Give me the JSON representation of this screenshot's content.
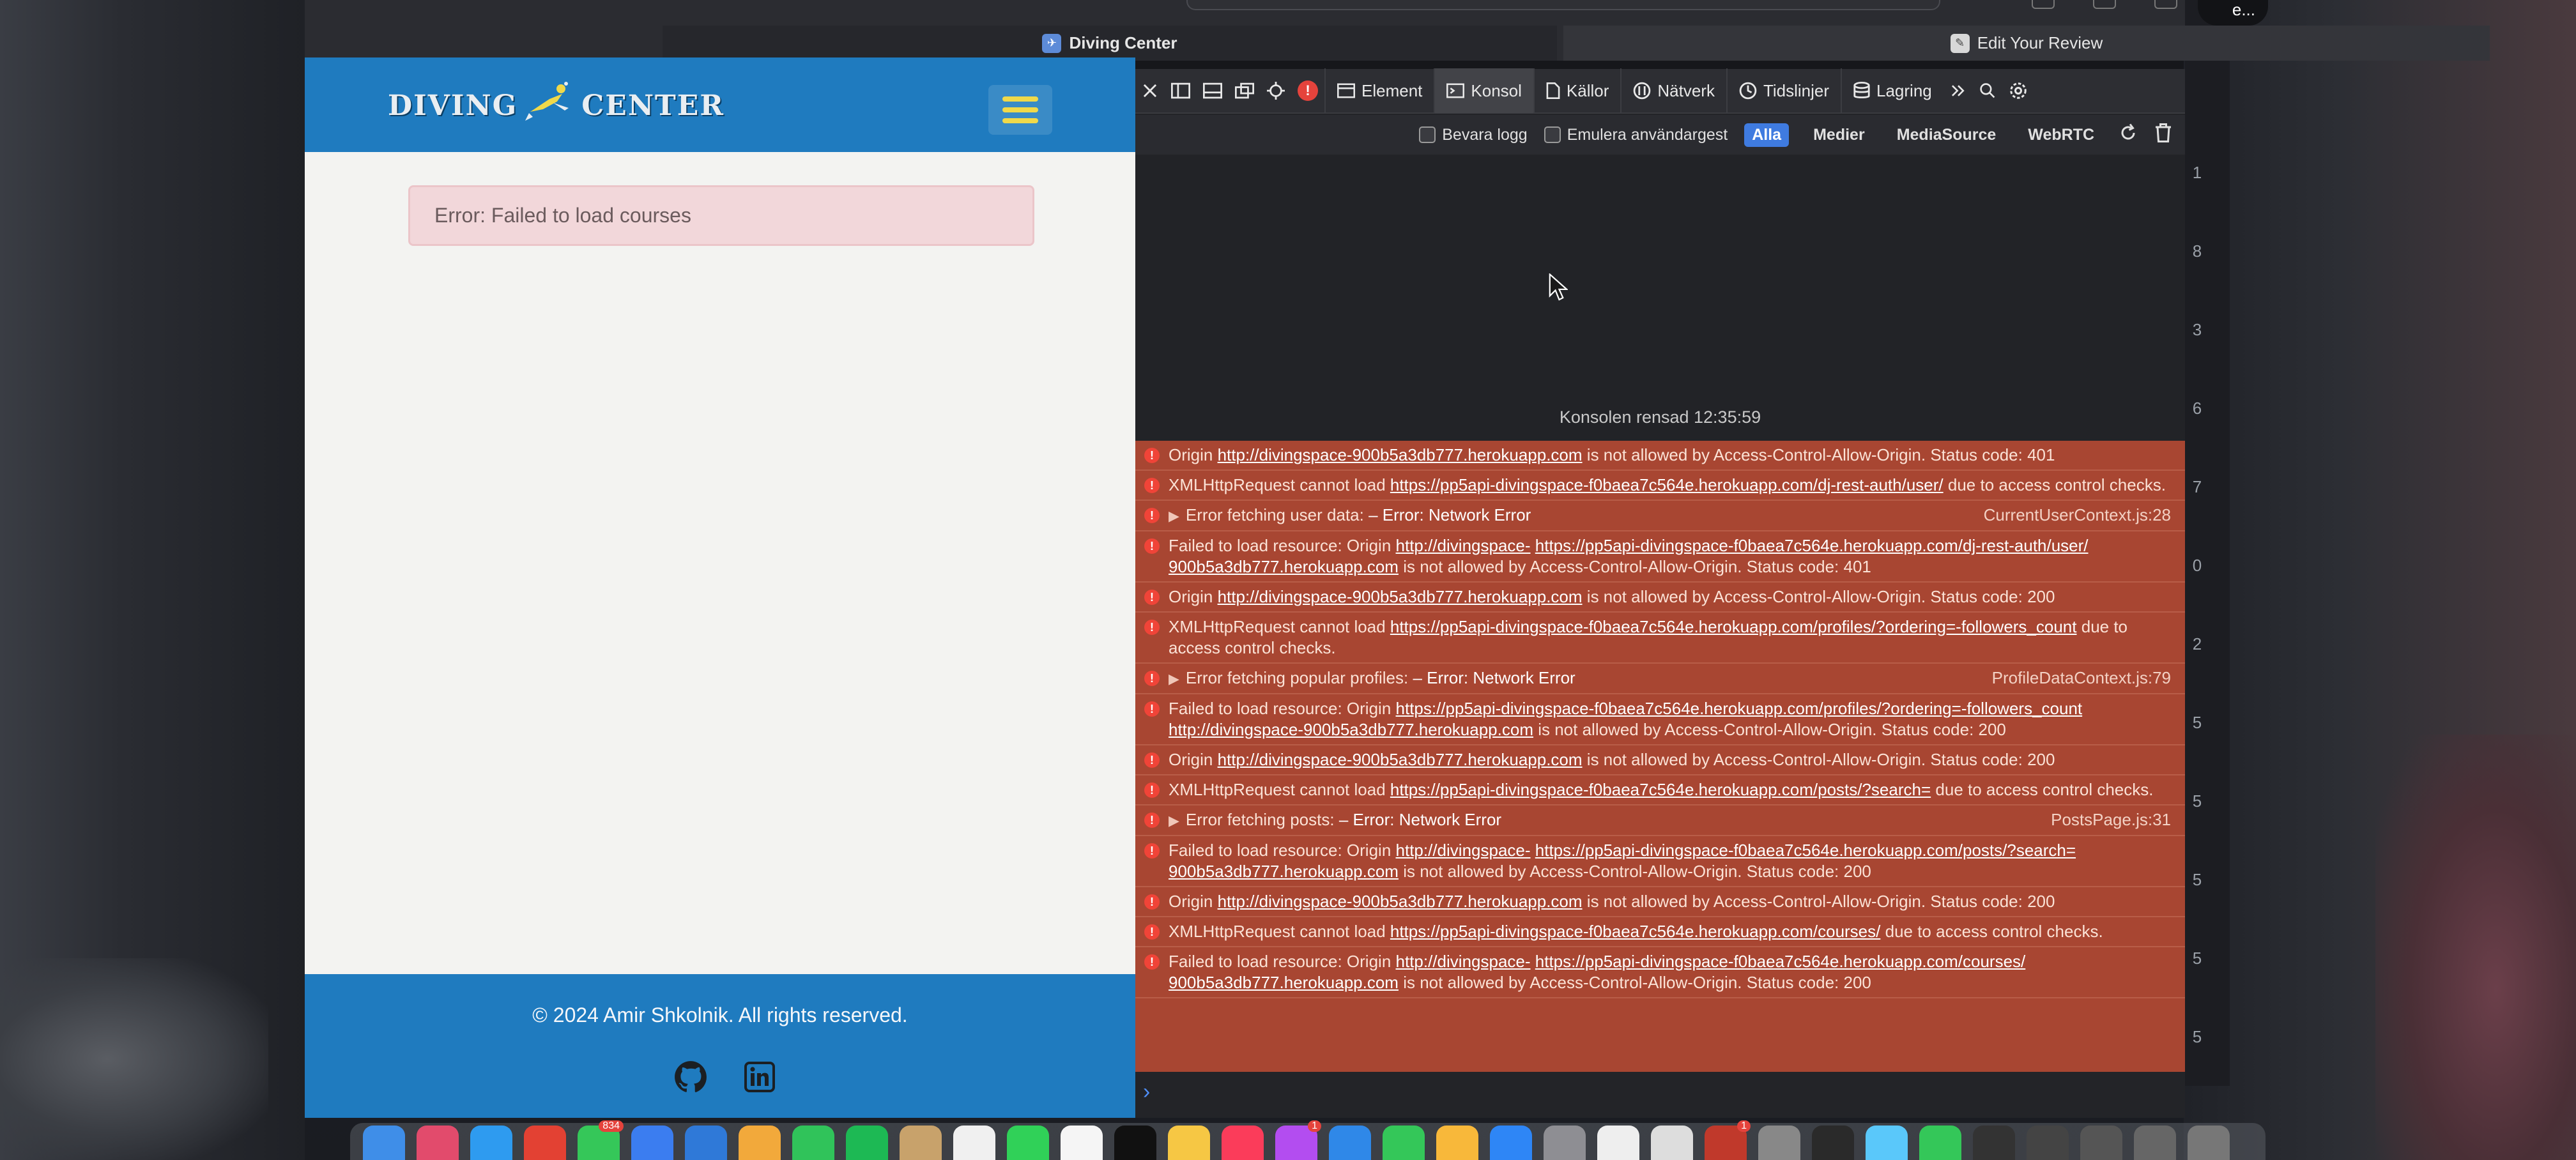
{
  "browser": {
    "tabs": [
      {
        "label": "Diving Center",
        "active": true
      },
      {
        "label": "Edit Your Review",
        "active": false
      }
    ],
    "top_right_text": "e..."
  },
  "site": {
    "logo_text_left": "DIVING",
    "logo_text_right": "CENTER",
    "error_message": "Error: Failed to load courses",
    "footer": {
      "copyright": "© 2024 Amir Shkolnik. All rights reserved.",
      "social": [
        "github-icon",
        "linkedin-icon"
      ]
    },
    "colors": {
      "header": "#1f7bbf",
      "hamburger": "#f0d94a",
      "error_bg": "#f2d7da"
    }
  },
  "devtools": {
    "tabs": [
      "Element",
      "Konsol",
      "Källor",
      "Nätverk",
      "Tidslinjer",
      "Lagring"
    ],
    "active_tab": "Konsol",
    "filter": {
      "preserve_log": "Bevara logg",
      "emulate": "Emulera användargest",
      "levels": [
        "Alla",
        "Medier",
        "MediaSource",
        "WebRTC"
      ],
      "active_level": "Alla"
    },
    "cleared_text": "Konsolen rensad 12:35:59",
    "messages": [
      {
        "parts": [
          {
            "t": "Origin "
          },
          {
            "l": "http://divingspace-900b5a3db777.herokuapp.com"
          },
          {
            "t": " is not allowed by Access-Control-Allow-Origin. Status code: 401"
          }
        ]
      },
      {
        "parts": [
          {
            "t": "XMLHttpRequest cannot load "
          },
          {
            "l": "https://pp5api-divingspace-f0baea7c564e.herokuapp.com/dj-rest-auth/user/"
          },
          {
            "t": " due to access control checks."
          }
        ]
      },
      {
        "group": true,
        "label": "Error fetching user data:",
        "detail": "– Error: Network Error",
        "source": "CurrentUserContext.js:28"
      },
      {
        "parts": [
          {
            "t": "Failed to load resource: Origin "
          },
          {
            "l": "http://divingspace-"
          },
          {
            "l": "https://pp5api-divingspace-f0baea7c564e.herokuapp.com/dj-rest-auth/user/"
          },
          {
            "l": "900b5a3db777.herokuapp.com"
          },
          {
            "t": " is not allowed by Access-Control-Allow-Origin. Status code: 401"
          }
        ]
      },
      {
        "parts": [
          {
            "t": "Origin "
          },
          {
            "l": "http://divingspace-900b5a3db777.herokuapp.com"
          },
          {
            "t": " is not allowed by Access-Control-Allow-Origin. Status code: 200"
          }
        ]
      },
      {
        "parts": [
          {
            "t": "XMLHttpRequest cannot load "
          },
          {
            "l": "https://pp5api-divingspace-f0baea7c564e.herokuapp.com/profiles/?ordering=-followers_count"
          },
          {
            "t": " due to access control checks."
          }
        ]
      },
      {
        "group": true,
        "label": "Error fetching popular profiles:",
        "detail": "– Error: Network Error",
        "source": "ProfileDataContext.js:79"
      },
      {
        "parts": [
          {
            "t": "Failed to load resource: Origin  "
          },
          {
            "l": "https://pp5api-divingspace-f0baea7c564e.herokuapp.com/profiles/?ordering=-followers_count"
          },
          {
            "l": "http://divingspace-900b5a3db777.herokuapp.com"
          },
          {
            "t": " is not allowed by Access-Control-Allow-Origin. Status code: 200"
          }
        ]
      },
      {
        "parts": [
          {
            "t": "Origin "
          },
          {
            "l": "http://divingspace-900b5a3db777.herokuapp.com"
          },
          {
            "t": " is not allowed by Access-Control-Allow-Origin. Status code: 200"
          }
        ]
      },
      {
        "parts": [
          {
            "t": "XMLHttpRequest cannot load "
          },
          {
            "l": "https://pp5api-divingspace-f0baea7c564e.herokuapp.com/posts/?search="
          },
          {
            "t": " due to access control checks."
          }
        ]
      },
      {
        "group": true,
        "label": "Error fetching posts:",
        "detail": "– Error: Network Error",
        "source": "PostsPage.js:31"
      },
      {
        "parts": [
          {
            "t": "Failed to load resource: Origin "
          },
          {
            "l": "http://divingspace-"
          },
          {
            "l": "https://pp5api-divingspace-f0baea7c564e.herokuapp.com/posts/?search="
          },
          {
            "l": "900b5a3db777.herokuapp.com"
          },
          {
            "t": " is not allowed by Access-Control-Allow-Origin. Status code: 200"
          }
        ]
      },
      {
        "parts": [
          {
            "t": "Origin "
          },
          {
            "l": "http://divingspace-900b5a3db777.herokuapp.com"
          },
          {
            "t": " is not allowed by Access-Control-Allow-Origin. Status code: 200"
          }
        ]
      },
      {
        "parts": [
          {
            "t": "XMLHttpRequest cannot load "
          },
          {
            "l": "https://pp5api-divingspace-f0baea7c564e.herokuapp.com/courses/"
          },
          {
            "t": " due to access control checks."
          }
        ]
      },
      {
        "parts": [
          {
            "t": "Failed to load resource: Origin "
          },
          {
            "l": "http://divingspace-"
          },
          {
            "l": "https://pp5api-divingspace-f0baea7c564e.herokuapp.com/courses/"
          },
          {
            "l": "900b5a3db777.herokuapp.com"
          },
          {
            "t": " is not allowed by Access-Control-Allow-Origin. Status code: 200"
          }
        ]
      }
    ],
    "prompt": "›"
  },
  "side_numbers": [
    "1",
    "8",
    "3",
    "6",
    "7",
    "0",
    "2",
    "5",
    "5",
    "5",
    "5",
    "5"
  ],
  "dock_badges": [
    "834",
    "1",
    "1"
  ]
}
